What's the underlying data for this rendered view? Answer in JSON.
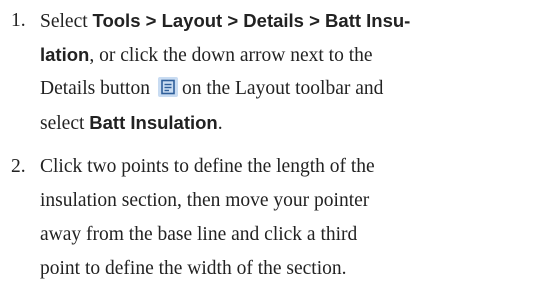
{
  "steps": [
    {
      "number": "1.",
      "lines": [
        {
          "parts": [
            {
              "text": "Select ",
              "style": "normal"
            },
            {
              "text": "Tools > Layout > Details > Batt Insu-",
              "style": "ui"
            }
          ]
        },
        {
          "parts": [
            {
              "text": "lation",
              "style": "ui"
            },
            {
              "text": ", or click the down arrow next to the",
              "style": "normal"
            }
          ]
        },
        {
          "parts": [
            {
              "text": "Details button",
              "style": "normal"
            },
            {
              "icon": "details-icon"
            },
            {
              "text": "on the Layout toolbar and",
              "style": "normal"
            }
          ]
        },
        {
          "parts": [
            {
              "text": "select ",
              "style": "normal"
            },
            {
              "text": "Batt Insulation",
              "style": "ui"
            },
            {
              "text": ".",
              "style": "normal"
            }
          ]
        }
      ]
    },
    {
      "number": "2.",
      "lines": [
        {
          "parts": [
            {
              "text": "Click two points to define the length of the",
              "style": "normal"
            }
          ]
        },
        {
          "parts": [
            {
              "text": "insulation section, then move your pointer",
              "style": "normal"
            }
          ]
        },
        {
          "parts": [
            {
              "text": "away from the base line and click a third",
              "style": "normal"
            }
          ]
        },
        {
          "parts": [
            {
              "text": "point to define the width of the section.",
              "style": "normal"
            }
          ]
        }
      ]
    }
  ],
  "colors": {
    "text": "#222222",
    "icon_bg": "#c9dcf2",
    "icon_stroke": "#2f5f9a"
  }
}
